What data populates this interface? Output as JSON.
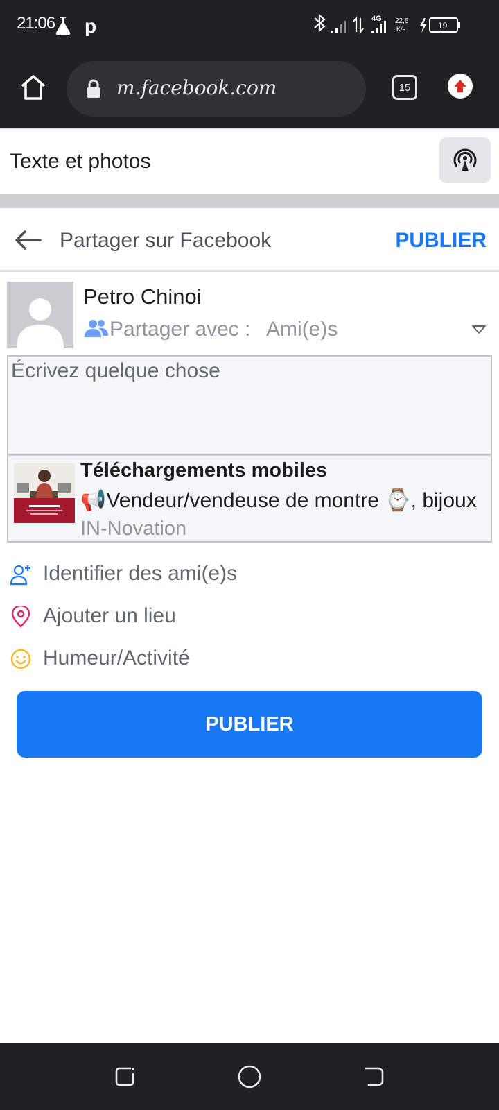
{
  "status_bar": {
    "time": "21:06",
    "network": "4G",
    "speed": "22,6",
    "speed_unit": "K/s",
    "battery": "19"
  },
  "browser": {
    "url": "m.facebook.com",
    "tab_count": "15"
  },
  "page_header": {
    "title": "Texte et photos"
  },
  "composer_header": {
    "title": "Partager sur Facebook",
    "publish_label": "PUBLIER"
  },
  "composer": {
    "user_name": "Petro Chinoi",
    "share_with_label": "Partager avec :",
    "audience": "Ami(e)s",
    "placeholder": "Écrivez quelque chose"
  },
  "link_preview": {
    "title": "Téléchargements mobiles",
    "description": "📢Vendeur/vendeuse de montre ⌚, bijoux",
    "source": "IN-Novation"
  },
  "actions": [
    {
      "label": "Identifier des ami(e)s",
      "icon": "tag-friends-icon",
      "color": "#1877f2"
    },
    {
      "label": "Ajouter un lieu",
      "icon": "location-pin-icon",
      "color": "#e2246a"
    },
    {
      "label": "Humeur/Activité",
      "icon": "smiley-icon",
      "color": "#f7b928"
    }
  ],
  "publish_button_label": "PUBLIER",
  "colors": {
    "accent": "#1877f2",
    "system_bar": "#202124"
  }
}
